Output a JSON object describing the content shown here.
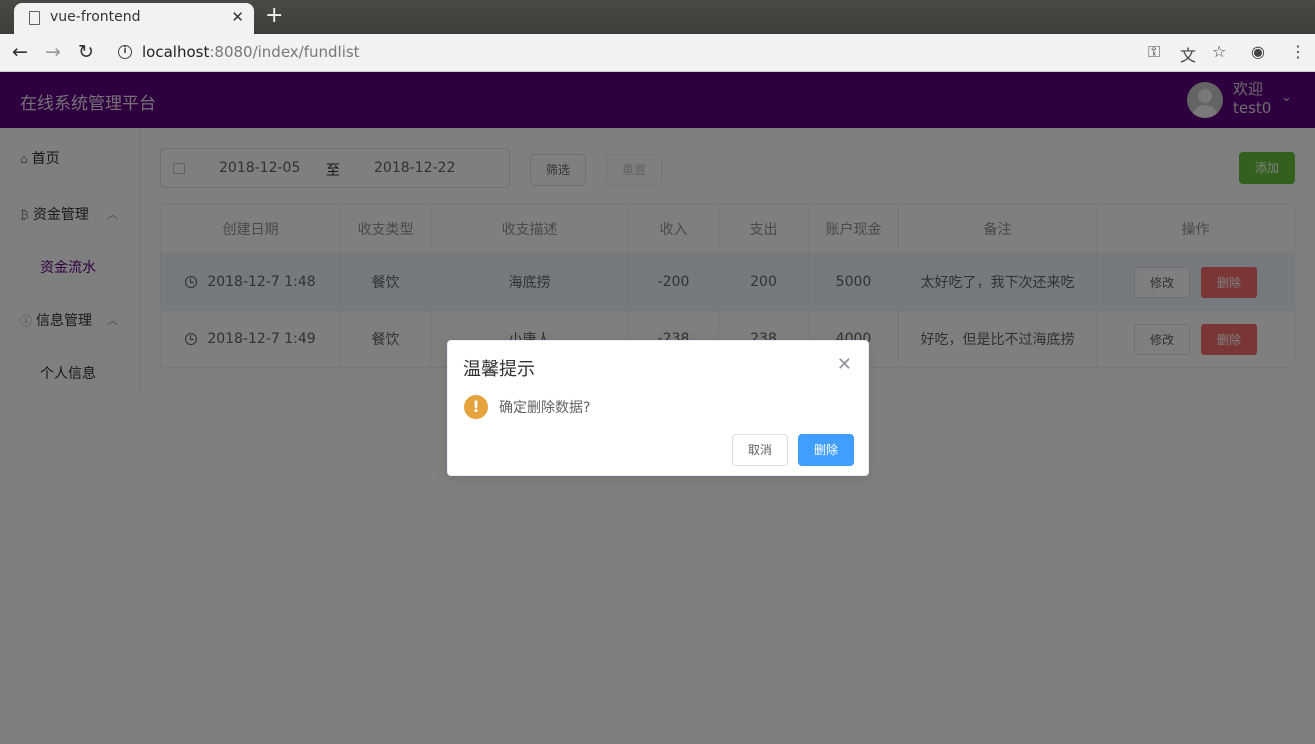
{
  "browser": {
    "tab_title": "vue-frontend",
    "tab_close": "✕",
    "new_tab": "+",
    "url_host": "localhost",
    "url_rest": ":8080/index/fundlist",
    "info_glyph": "i"
  },
  "header": {
    "title": "在线系统管理平台",
    "welcome_line1": "欢迎",
    "welcome_line2": "test0"
  },
  "sidebar": {
    "home": "首页",
    "fund_management": "资金管理",
    "fund_flow": "资金流水",
    "info_management": "信息管理",
    "personal_info": "个人信息"
  },
  "toolbar": {
    "start_date": "2018-12-05",
    "separator": "至",
    "end_date": "2018-12-22",
    "filter": "筛选",
    "reset": "重置",
    "add": "添加"
  },
  "table": {
    "headers": [
      "创建日期",
      "收支类型",
      "收支描述",
      "收入",
      "支出",
      "账户现金",
      "备注",
      "操作"
    ],
    "rows": [
      {
        "date": "2018-12-7 1:48",
        "type": "餐饮",
        "desc": "海底捞",
        "income": "-200",
        "expense": "200",
        "cash": "5000",
        "remark": "太好吃了，我下次还来吃",
        "edit": "修改",
        "delete": "删除"
      },
      {
        "date": "2018-12-7 1:49",
        "type": "餐饮",
        "desc": "小唐人",
        "income": "-238",
        "expense": "238",
        "cash": "4000",
        "remark": "好吃，但是比不过海底捞",
        "edit": "修改",
        "delete": "删除"
      }
    ]
  },
  "dialog": {
    "title": "温馨提示",
    "message": "确定删除数据?",
    "warn_glyph": "!",
    "cancel": "取消",
    "confirm": "删除"
  },
  "colors": {
    "header_bg": "#5f017f",
    "success": "#67c23a",
    "danger": "#f56c6c",
    "primary": "#409eff",
    "warning": "#e6a23c"
  },
  "icons": [
    "back-icon",
    "forward-icon",
    "reload-icon",
    "info-icon",
    "key-icon",
    "translate-icon",
    "star-icon",
    "account-icon",
    "menu-icon",
    "home-icon",
    "bitcoin-icon",
    "info-circle-icon",
    "calendar-icon",
    "clock-icon",
    "warning-icon",
    "close-icon",
    "chevron-up-icon",
    "chevron-down-icon"
  ]
}
